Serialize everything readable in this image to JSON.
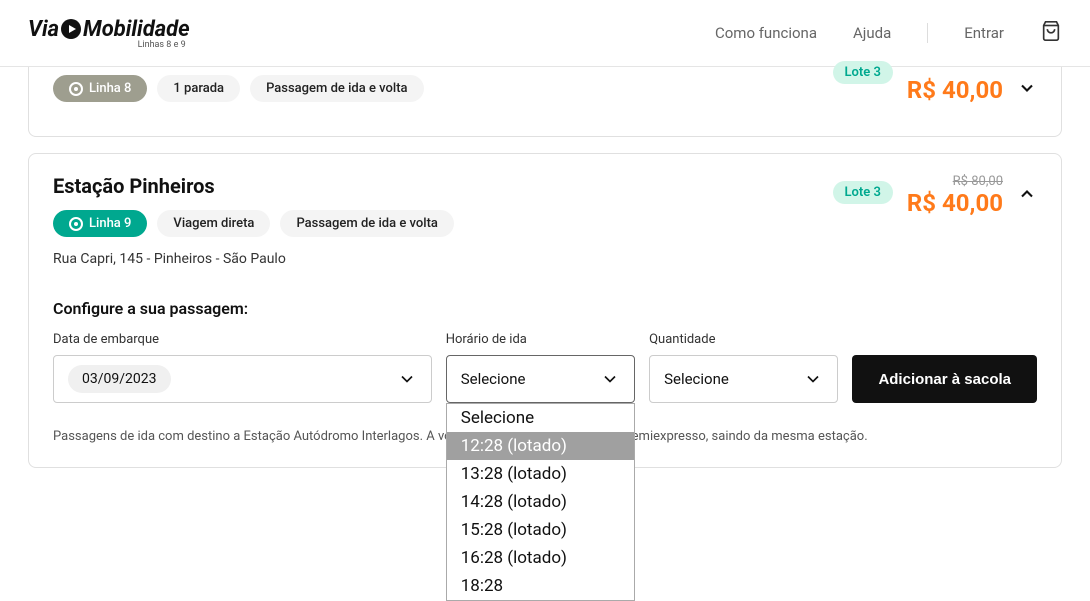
{
  "header": {
    "logo_prefix": "Via",
    "logo_suffix": "Mobilidade",
    "logo_sub": "Linhas 8 e 9",
    "nav": {
      "how": "Como funciona",
      "help": "Ajuda",
      "enter": "Entrar"
    }
  },
  "card1": {
    "line_label": "Linha 8",
    "stops": "1 parada",
    "trip_type": "Passagem de ida e volta",
    "lote": "Lote 3",
    "price": "R$ 40,00"
  },
  "card2": {
    "title": "Estação Pinheiros",
    "line_label": "Linha 9",
    "direct": "Viagem direta",
    "trip_type": "Passagem de ida e volta",
    "address": "Rua Capri, 145 - Pinheiros - São Paulo",
    "lote": "Lote 3",
    "old_price": "R$ 80,00",
    "price": "R$ 40,00",
    "config_title": "Configure a sua passagem:",
    "fields": {
      "date_label": "Data de embarque",
      "date_value": "03/09/2023",
      "time_label": "Horário de ida",
      "time_placeholder": "Selecione",
      "qty_label": "Quantidade",
      "qty_placeholder": "Selecione"
    },
    "add_button": "Adicionar à sacola",
    "dropdown": {
      "opt0": "Selecione",
      "opt1": "12:28 (lotado)",
      "opt2": "13:28 (lotado)",
      "opt3": "14:28 (lotado)",
      "opt4": "15:28 (lotado)",
      "opt5": "16:28 (lotado)",
      "opt6": "18:28"
    },
    "note": "Passagens de ida com destino a Estação Autódromo Interlagos. A volta será realizada por formato semiexpresso, saindo da mesma estação."
  }
}
